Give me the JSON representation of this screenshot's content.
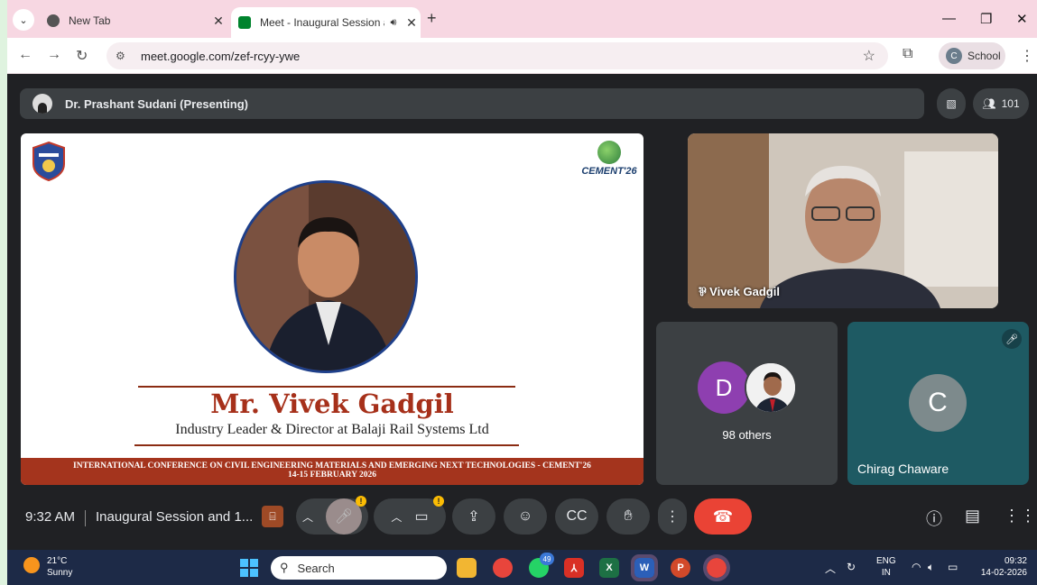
{
  "browser": {
    "tabs": [
      {
        "title": "New Tab"
      },
      {
        "title": "Meet - Inaugural Session an"
      }
    ],
    "url": "meet.google.com/zef-rcyy-ywe",
    "profile_label": "School",
    "profile_initial": "C"
  },
  "meet": {
    "presenter_label": "Dr. Prashant Sudani (Presenting)",
    "participant_count": "101",
    "slide": {
      "logo_right_text": "CEMENT'26",
      "speaker_name": "Mr. Vivek Gadgil",
      "speaker_role": "Industry Leader & Director at Balaji Rail Systems Ltd",
      "conference_line1": "INTERNATIONAL CONFERENCE ON CIVIL ENGINEERING MATERIALS AND EMERGING NEXT TECHNOLOGIES - CEMENT'26",
      "conference_line2": "14-15 FEBRUARY 2026"
    },
    "tiles": {
      "vivek_name": "Vivek Gadgil",
      "others_initial": "D",
      "others_count": "98 others",
      "chirag_initial": "C",
      "chirag_name": "Chirag Chaware"
    },
    "bottom": {
      "time": "9:32 AM",
      "meeting_name": "Inaugural Session and 1...",
      "warn_mark": "!"
    }
  },
  "taskbar": {
    "temperature": "21°C",
    "weather": "Sunny",
    "search_placeholder": "Search",
    "whatsapp_badge": "49",
    "lang_line1": "ENG",
    "lang_line2": "IN",
    "clock_time": "09:32",
    "clock_date": "14-02-2026"
  },
  "colors": {
    "tabstrip": "#f7d7e2",
    "meet_bg": "#202124",
    "end_call": "#ea4335",
    "slide_accent": "#a4341d",
    "taskbar": "#1d2a47"
  }
}
